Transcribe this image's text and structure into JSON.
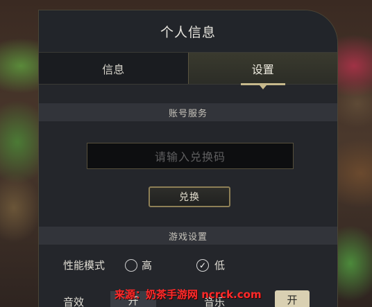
{
  "panel": {
    "title": "个人信息",
    "tabs": [
      {
        "label": "信息",
        "active": false
      },
      {
        "label": "设置",
        "active": true
      }
    ]
  },
  "account": {
    "section_title": "账号服务",
    "code_placeholder": "请输入兑换码",
    "redeem_label": "兑换"
  },
  "game_settings": {
    "section_title": "游戏设置",
    "performance": {
      "label": "性能模式",
      "options": [
        {
          "label": "高",
          "checked": false
        },
        {
          "label": "低",
          "checked": true
        }
      ]
    },
    "sound_effects": {
      "label": "音效",
      "value": "开"
    },
    "music": {
      "label": "音乐",
      "value": "开"
    }
  },
  "watermark": "来源：奶茶手游网 ncrck.com",
  "colors": {
    "panel_bg": "#24262b",
    "accent_gold": "#c7b98c",
    "watermark_red": "#ff2a2a"
  }
}
